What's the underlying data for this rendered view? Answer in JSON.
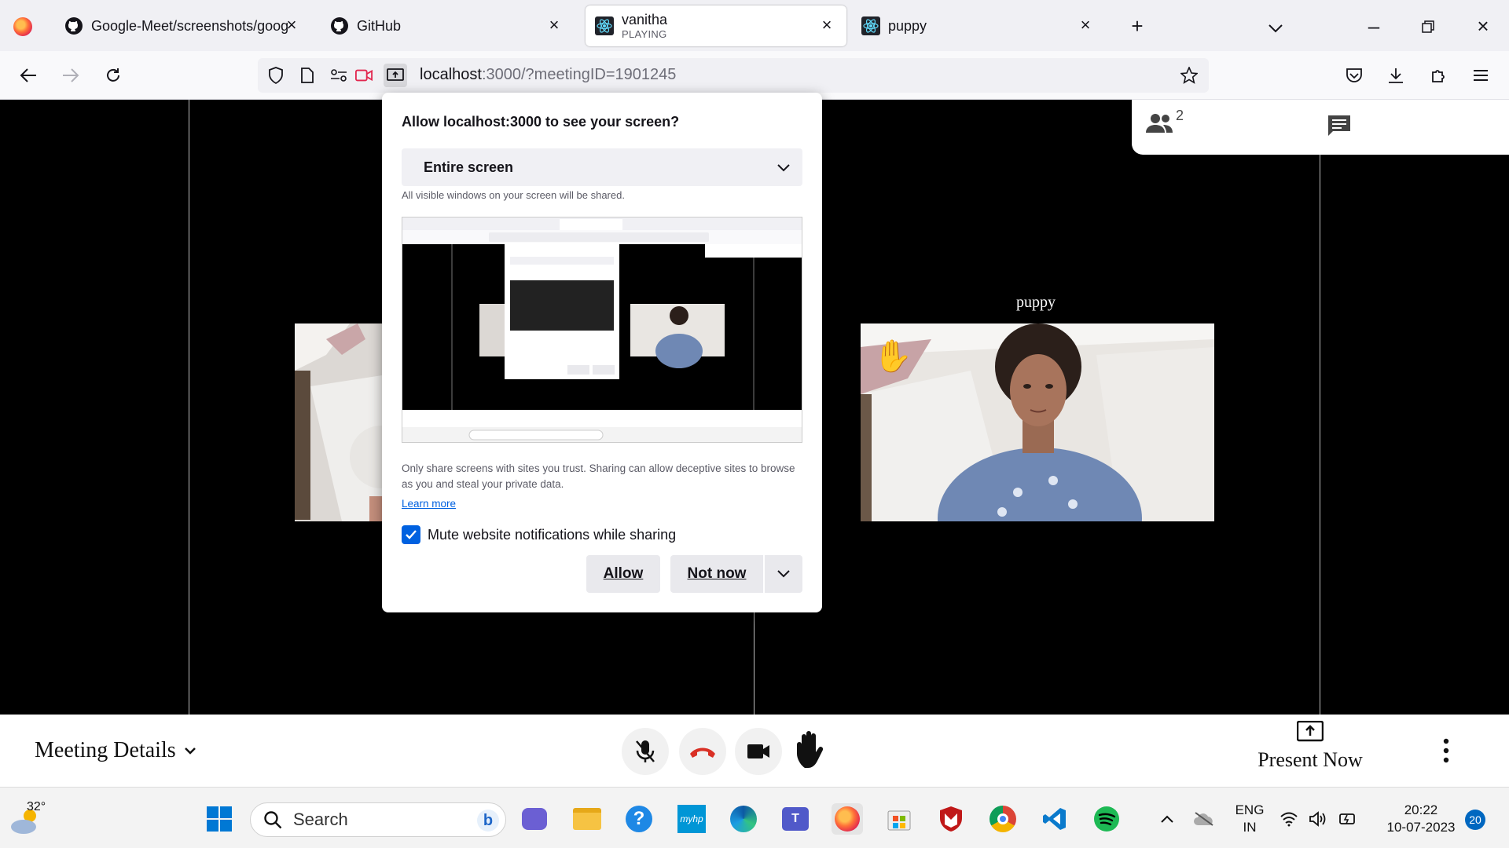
{
  "browser": {
    "tabs": [
      {
        "title": "Google-Meet/screenshots/goog",
        "icon": "github-icon"
      },
      {
        "title": "GitHub",
        "icon": "github-icon"
      },
      {
        "title": "vanitha",
        "subtitle": "PLAYING",
        "icon": "react-icon",
        "active": true
      },
      {
        "title": "puppy",
        "icon": "react-icon"
      }
    ],
    "url_host": "localhost",
    "url_rest": ":3000/?meetingID=1901245"
  },
  "meeting": {
    "participant_name": "puppy",
    "participant_count": "2",
    "meeting_details_label": "Meeting Details",
    "present_label": "Present Now"
  },
  "dialog": {
    "title": "Allow localhost:3000 to see your screen?",
    "selected_source": "Entire screen",
    "hint": "All visible windows on your screen will be shared.",
    "warning": "Only share screens with sites you trust. Sharing can allow deceptive sites to browse as you and steal your private data.",
    "learn_more": "Learn more",
    "mute_label": "Mute website notifications while sharing",
    "mute_checked": true,
    "allow_label": "Allow",
    "not_now_label": "Not now"
  },
  "taskbar": {
    "weather_temp": "32°",
    "search_label": "Search",
    "lang_line1": "ENG",
    "lang_line2": "IN",
    "time": "20:22",
    "date": "10-07-2023",
    "notification_count": "20"
  },
  "colors": {
    "accent": "#0061e0",
    "end_call": "#d93025",
    "hand_raise": "#f5c518"
  }
}
